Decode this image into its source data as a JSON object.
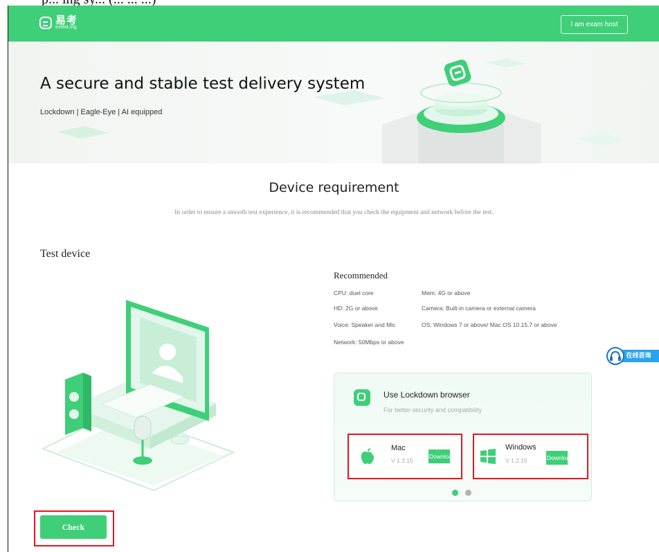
{
  "caption_fragment": "p... ing sy... (... ... ...)",
  "header": {
    "logo_cn": "易考",
    "logo_sub": "eztest.org",
    "host_button": "I am exam host"
  },
  "banner": {
    "title": "A secure and stable test delivery system",
    "subtitle": "Lockdown | Eagle-Eye | AI equipped"
  },
  "requirement": {
    "title": "Device requirement",
    "description": "In order to ensure a smooth test experience, it is recommended that you check the equipment and network before the test."
  },
  "test_device": {
    "title": "Test device"
  },
  "recommended": {
    "title": "Recommended",
    "cpu": "CPU: duel core",
    "mem": "Mem: 4G or above",
    "hd": "HD: 2G or above",
    "camera": "Camera: Built-in camera or external camera",
    "voice": "Voice: Speaker and Mic",
    "os": "OS: Windows 7 or above/ Mac OS 10.15.7 or above",
    "network": "Network: 50Mbps or above"
  },
  "lockdown": {
    "title": "Use Lockdown browser",
    "subtitle": "For better security and compatibility",
    "mac": {
      "name": "Mac",
      "version": "V 1.2.15",
      "button": "Download"
    },
    "windows": {
      "name": "Windows",
      "version": "V 1.2.15",
      "button": "Download"
    },
    "active_slide": 1,
    "slide_count": 2
  },
  "check_button": "Check",
  "chat_widget": "在线咨询",
  "colors": {
    "brand_green": "#3fcf78",
    "highlight_red": "#e8141e",
    "chat_blue": "#29a3f0"
  }
}
